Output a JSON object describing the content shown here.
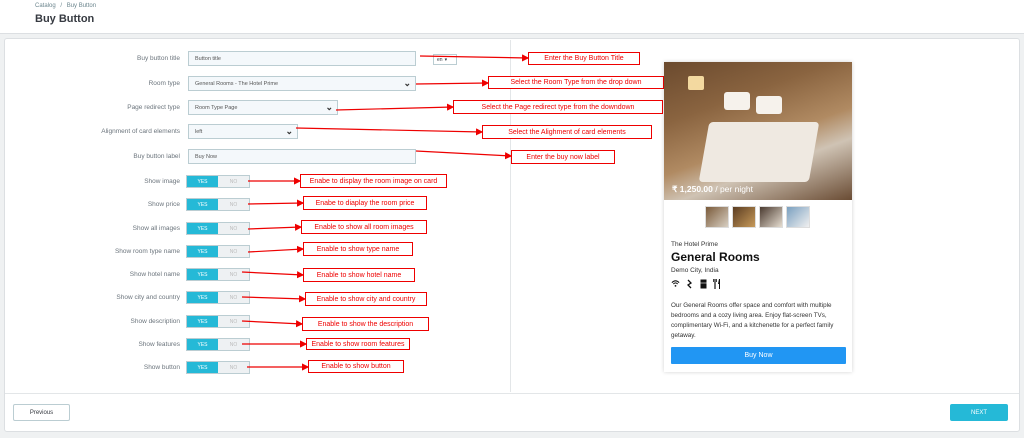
{
  "breadcrumb": [
    "Catalog",
    "/",
    "Buy Button"
  ],
  "page_title": "Buy Button",
  "form": {
    "title_label": "Buy button title",
    "title_value": "Button title",
    "lang": "en",
    "room_type_label": "Room type",
    "room_type_value": "General Rooms - The Hotel Prime",
    "redirect_label": "Page redirect type",
    "redirect_value": "Room Type Page",
    "alignment_label": "Alignment of card elements",
    "alignment_value": "left",
    "buy_label_label": "Buy button label",
    "buy_label_value": "Buy Now",
    "yes": "YES",
    "no": "NO",
    "toggles": [
      "Show image",
      "Show price",
      "Show all images",
      "Show room type name",
      "Show hotel name",
      "Show city and country",
      "Show description",
      "Show features",
      "Show button"
    ]
  },
  "annotations": [
    "Enter the Buy Button Title",
    "Select the Room Type from the drop down",
    "Select the Page redirect type from the downdown",
    "Select the Alighment of card elements",
    "Enter the buy now label",
    "Enabe to display the room image on card",
    "Enabe to diaplay the room price",
    "Enable to show all room images",
    "Enable to show type name",
    "Enable to show hotel name",
    "Enable to show city and country",
    "Enable to show the description",
    "Enable to show room features",
    "Enable to show button"
  ],
  "preview": {
    "price": "₹ 1,250.00",
    "per_night": " / per night",
    "hotel_name": "The Hotel Prime",
    "room_title": "General Rooms",
    "city": "Demo City, India",
    "features": [
      "wifi-icon",
      "hair-dryer-icon",
      "fridge-icon",
      "restaurant-icon"
    ],
    "description": "Our General Rooms offer space and comfort with multiple bedrooms and a cozy living area. Enjoy flat-screen TVs, complimentary Wi-Fi, and a kitchenette for a perfect family getaway.",
    "button": "Buy Now"
  },
  "footer": {
    "previous": "Previous",
    "next": "NEXT"
  },
  "colors": {
    "accent": "#25b9d7",
    "annotation": "#e00000",
    "buy_button": "#2196f3"
  }
}
